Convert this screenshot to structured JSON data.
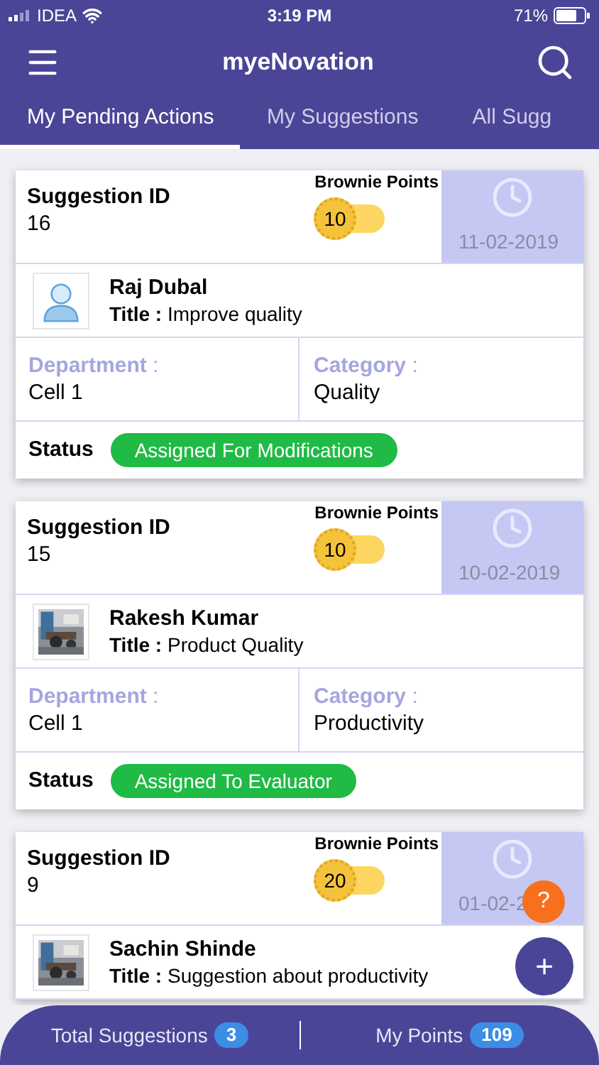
{
  "status_bar": {
    "carrier": "IDEA",
    "time": "3:19 PM",
    "battery": "71%"
  },
  "header": {
    "title": "myeNovation"
  },
  "tabs": [
    {
      "label": "My Pending Actions",
      "selected": true
    },
    {
      "label": "My Suggestions",
      "selected": false
    },
    {
      "label": "All Sugg",
      "selected": false
    }
  ],
  "cards": [
    {
      "id_label": "Suggestion ID",
      "id": "16",
      "points_label": "Brownie Points",
      "points": "10",
      "date": "11-02-2019",
      "avatar": {
        "kind": "icon"
      },
      "name": "Raj Dubal",
      "title_label": "Title",
      "title_sep": ":",
      "title": "Improve quality",
      "department_label": "Department",
      "department_sep": ":",
      "department": "Cell 1",
      "category_label": "Category",
      "category_sep": ":",
      "category": "Quality",
      "status_label": "Status",
      "status": "Assigned For Modifications"
    },
    {
      "id_label": "Suggestion ID",
      "id": "15",
      "points_label": "Brownie Points",
      "points": "10",
      "date": "10-02-2019",
      "name": "Rakesh Kumar",
      "title_label": "Title",
      "title_sep": ":",
      "title": "Product Quality",
      "department_label": "Department",
      "department_sep": ":",
      "department": "Cell 1",
      "category_label": "Category",
      "category_sep": ":",
      "category": "Productivity",
      "status_label": "Status",
      "status": "Assigned To Evaluator"
    },
    {
      "id_label": "Suggestion ID",
      "id": "9",
      "points_label": "Brownie Points",
      "points": "20",
      "date": "01-02-2",
      "name": "Sachin Shinde",
      "title_label": "Title",
      "title_sep": ":",
      "title": "Suggestion about productivity"
    }
  ],
  "help_button": {
    "label": "?"
  },
  "add_button": {
    "label": "+"
  },
  "bottom_bar": {
    "total_label": "Total Suggestions",
    "total": "3",
    "points_label": "My Points",
    "points": "109"
  }
}
